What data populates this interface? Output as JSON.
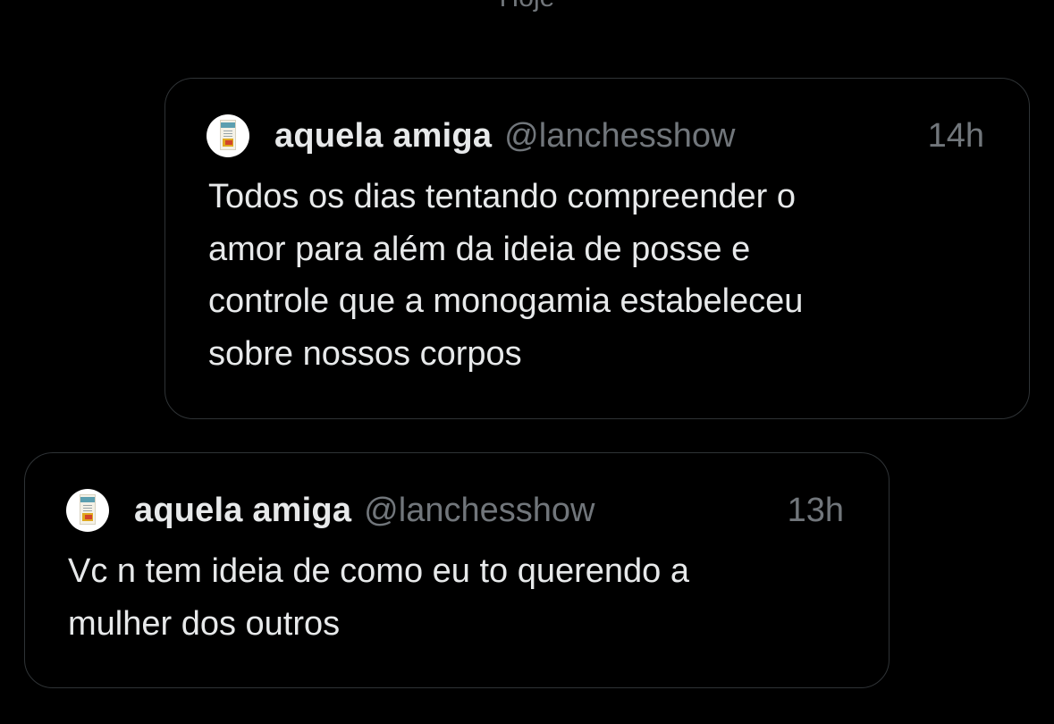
{
  "date_separator": "Hoje",
  "colors": {
    "background": "#000000",
    "text_primary": "#e7e9ea",
    "text_secondary": "#71767b",
    "card_border": "#2f3336"
  },
  "tweets": [
    {
      "avatar_icon": "medicine-box-avatar-icon",
      "display_name": "aquela amiga",
      "handle": "@lanchesshow",
      "time": "14h",
      "text": "Todos os dias tentando compreender o\namor para além da ideia de posse e\ncontrole que a monogamia estabeleceu\nsobre nossos corpos"
    },
    {
      "avatar_icon": "medicine-box-avatar-icon",
      "display_name": "aquela amiga",
      "handle": "@lanchesshow",
      "time": "13h",
      "text": "Vc n tem ideia de como eu to querendo a\nmulher dos outros"
    }
  ]
}
